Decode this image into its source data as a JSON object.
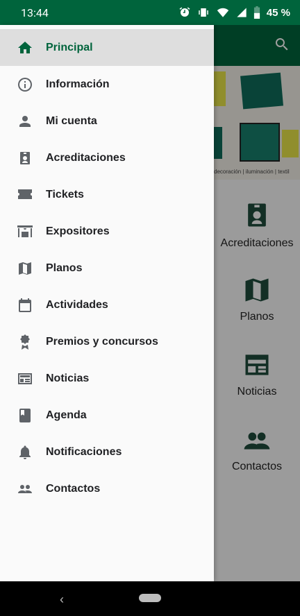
{
  "status_bar": {
    "time": "13:44",
    "battery": "45 %",
    "icons": [
      "alarm-icon",
      "vibrate-icon",
      "wifi-icon",
      "signal-icon",
      "battery-icon"
    ]
  },
  "app": {
    "banner_caption": "decoración | iluminación | textil",
    "tiles": [
      {
        "label": "Acreditaciones",
        "icon": "badge-icon"
      },
      {
        "label": "Planos",
        "icon": "map-icon"
      },
      {
        "label": "Noticias",
        "icon": "newspaper-icon"
      },
      {
        "label": "Contactos",
        "icon": "group-icon"
      }
    ]
  },
  "drawer": {
    "items": [
      {
        "label": "Principal",
        "icon": "home-icon",
        "active": true
      },
      {
        "label": "Información",
        "icon": "info-icon"
      },
      {
        "label": "Mi cuenta",
        "icon": "person-icon"
      },
      {
        "label": "Acreditaciones",
        "icon": "badge-icon"
      },
      {
        "label": "Tickets",
        "icon": "ticket-icon"
      },
      {
        "label": "Expositores",
        "icon": "store-icon"
      },
      {
        "label": "Planos",
        "icon": "map-icon"
      },
      {
        "label": "Actividades",
        "icon": "calendar-icon"
      },
      {
        "label": "Premios y concursos",
        "icon": "award-icon"
      },
      {
        "label": "Noticias",
        "icon": "newspaper-icon"
      },
      {
        "label": "Agenda",
        "icon": "book-icon"
      },
      {
        "label": "Notificaciones",
        "icon": "bell-icon"
      },
      {
        "label": "Contactos",
        "icon": "group-icon"
      }
    ]
  },
  "colors": {
    "brand": "#00643c",
    "active_background": "#dedede",
    "icon_grey": "#5f6368"
  }
}
